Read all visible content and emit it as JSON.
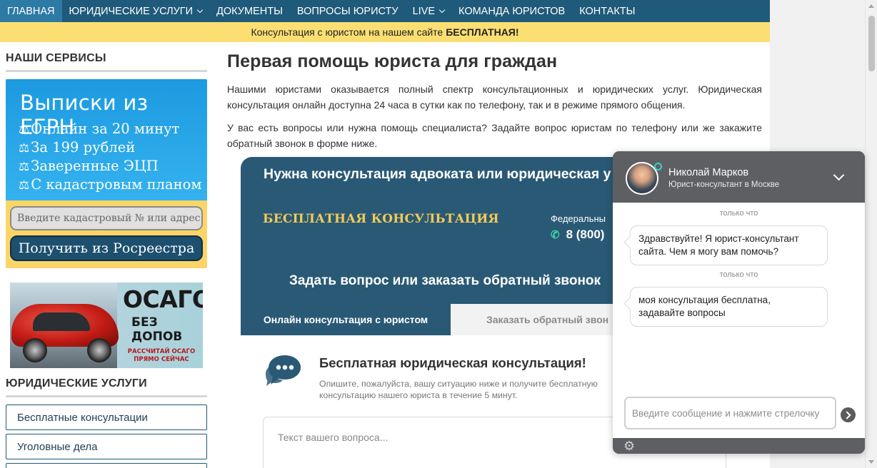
{
  "nav": {
    "items": [
      {
        "label": "ГЛАВНАЯ",
        "caret": false,
        "active": true
      },
      {
        "label": "ЮРИДИЧЕСКИЕ УСЛУГИ",
        "caret": true
      },
      {
        "label": "ДОКУМЕНТЫ",
        "caret": false
      },
      {
        "label": "ВОПРОСЫ ЮРИСТУ",
        "caret": false
      },
      {
        "label": "LIVE",
        "caret": true
      },
      {
        "label": "КОМАНДА ЮРИСТОВ",
        "caret": false
      },
      {
        "label": "КОНТАКТЫ",
        "caret": false
      }
    ]
  },
  "promo": {
    "text": "Консультация с юристом на нашем сайте",
    "bold": "БЕСПЛАТНАЯ!"
  },
  "sidebar": {
    "services_heading": "НАШИ СЕРВИСЫ",
    "egrn": {
      "title": "Выписки из ЕГРН",
      "lines": [
        "Онлайн за 20 минут",
        "За 199 рублей",
        "Заверенные ЭЦП",
        "С кадастровым планом"
      ],
      "input_placeholder": "Введите кадастровый № или адрес",
      "button": "Получить из Росреестра"
    },
    "osago": {
      "title": "ОСАГО",
      "subtitle": "БЕЗ ДОПОВ",
      "cta": "РАССЧИТАЙ ОСАГО ПРЯМО СЕЙЧАС"
    },
    "legal_heading": "ЮРИДИЧЕСКИЕ УСЛУГИ",
    "legal_items": [
      "Бесплатные консультации",
      "Уголовные дела"
    ]
  },
  "main": {
    "title": "Первая помощь юриста для граждан",
    "para1": "Нашими юристами оказывается полный спектр консультационных и юридических услуг. Юридическая консультация онлайн доступна 24 часа в сутки как по телефону, так и в режиме прямого общения.",
    "para2": "У вас есть вопросы или нужна помощь специалиста? Задайте вопрос юристам по телефону или же закажите обратный звонок в форме ниже."
  },
  "consult": {
    "title": "Нужна консультация адвоката или юридическая у",
    "free_label": "БЕСПЛАТНАЯ КОНСУЛЬТАЦИЯ",
    "federal_label": "Федеральны",
    "phone": "8 (800)",
    "ask_title": "Задать вопрос или заказать обратный звонок",
    "tab_online": "Онлайн консультация с юристом",
    "tab_callback": "Заказать обратный звон",
    "body_title": "Бесплатная юридическая консультация!",
    "body_sub": "Опишите, пожалуйста, вашу ситуацию ниже и получите бесплатную консультацию нашего юриста в течение 5 минут.",
    "question_placeholder": "Текст вашего вопроса..."
  },
  "chat": {
    "agent_name": "Николай Марков",
    "agent_role": "Юрист-консультант в Москве",
    "messages": [
      {
        "time": "только что",
        "text": "Здравствуйте! Я юрист-консультант сайта. Чем я могу вам помочь?"
      },
      {
        "time": "только что",
        "text": "моя консультация бесплатна, задавайте вопросы"
      }
    ],
    "input_placeholder": "Введите сообщение и нажмите стрелочку"
  },
  "colors": {
    "nav_bg": "#1f5a7a",
    "nav_active": "#2d7aa5",
    "promo_bg": "#fcdf72",
    "consult_bg": "#2a5975",
    "free_label": "#f3cb5a",
    "phone_icon": "#3dd6a8",
    "chat_bg": "#5e5f63"
  }
}
